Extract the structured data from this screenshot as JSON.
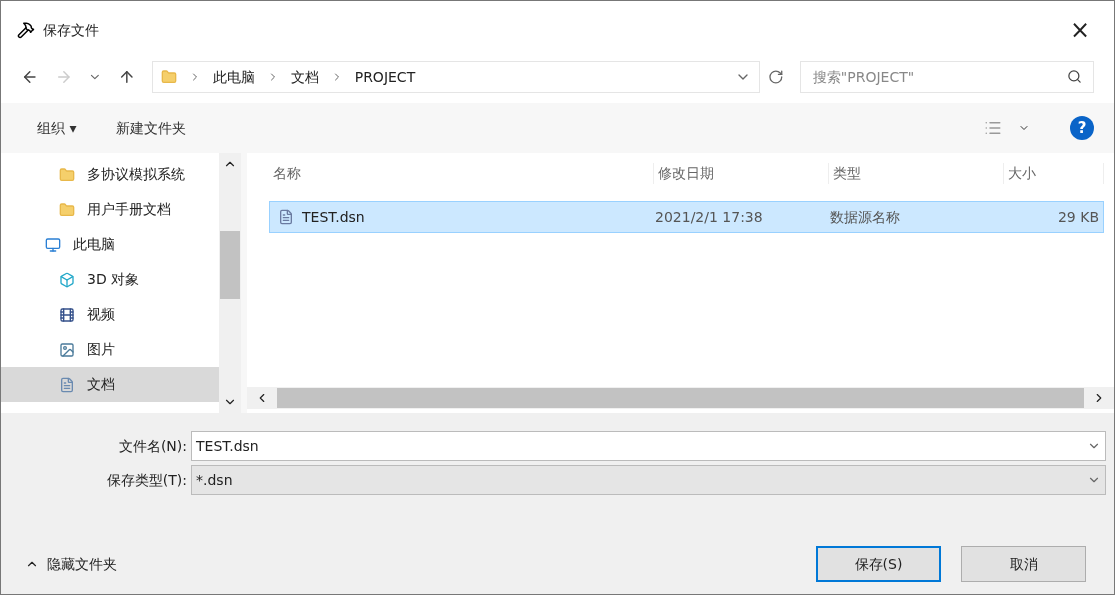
{
  "window": {
    "title": "保存文件",
    "close": "×"
  },
  "address": {
    "path": [
      "此电脑",
      "文档",
      "PROJECT"
    ]
  },
  "search": {
    "placeholder": "搜索\"PROJECT\""
  },
  "toolbar": {
    "organize": "组织 ▾",
    "new_folder": "新建文件夹",
    "help": "?"
  },
  "sidebar": {
    "items": [
      {
        "label": "多协议模拟系统",
        "kind": "folder",
        "selected": false
      },
      {
        "label": "用户手册文档",
        "kind": "folder",
        "selected": false
      },
      {
        "label": "此电脑",
        "kind": "pc",
        "selected": false,
        "children": [
          {
            "label": "3D 对象",
            "kind": "cube",
            "selected": false
          },
          {
            "label": "视频",
            "kind": "video",
            "selected": false
          },
          {
            "label": "图片",
            "kind": "picture",
            "selected": false
          },
          {
            "label": "文档",
            "kind": "document",
            "selected": true
          }
        ]
      }
    ]
  },
  "table": {
    "columns": [
      "名称",
      "修改日期",
      "类型",
      "大小"
    ],
    "rows": [
      {
        "name": "TEST.dsn",
        "date": "2021/2/1 17:38",
        "type": "数据源名称",
        "size": "29 KB",
        "selected": true
      }
    ]
  },
  "file_name": {
    "label": "文件名(N):",
    "value": "TEST.dsn"
  },
  "file_type": {
    "label": "保存类型(T):",
    "value": "*.dsn"
  },
  "hide_folders": "隐藏文件夹",
  "buttons": [
    {
      "label": "保存(S)",
      "kind": "primary"
    },
    {
      "label": "取消",
      "kind": "secondary"
    }
  ]
}
